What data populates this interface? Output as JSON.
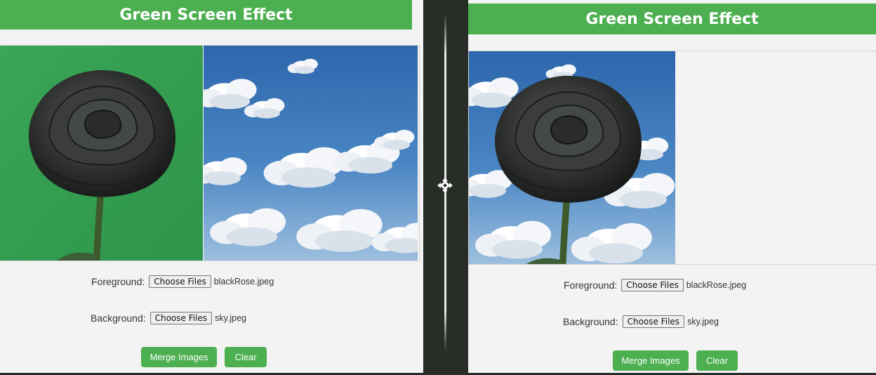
{
  "left_panel": {
    "title": "Green Screen Effect",
    "foreground_label": "Foreground:",
    "foreground_button": "Choose Files",
    "foreground_file": "blackRose.jpeg",
    "background_label": "Background:",
    "background_button": "Choose Files",
    "background_file": "sky.jpeg",
    "merge_button": "Merge Images",
    "clear_button": "Clear"
  },
  "right_panel": {
    "title": "Green Screen Effect",
    "foreground_label": "Foreground:",
    "foreground_button": "Choose Files",
    "foreground_file": "blackRose.jpeg",
    "background_label": "Background:",
    "background_button": "Choose Files",
    "background_file": "sky.jpeg",
    "merge_button": "Merge Images",
    "clear_button": "Clear"
  },
  "divider": {
    "handle_icon": "move-arrows-icon"
  },
  "colors": {
    "accent": "#4caf50",
    "page_bg": "#f3f3f3",
    "divider_bg": "#282d28",
    "green_screen": "#34a152",
    "sky_blue": "#3f78b8"
  }
}
